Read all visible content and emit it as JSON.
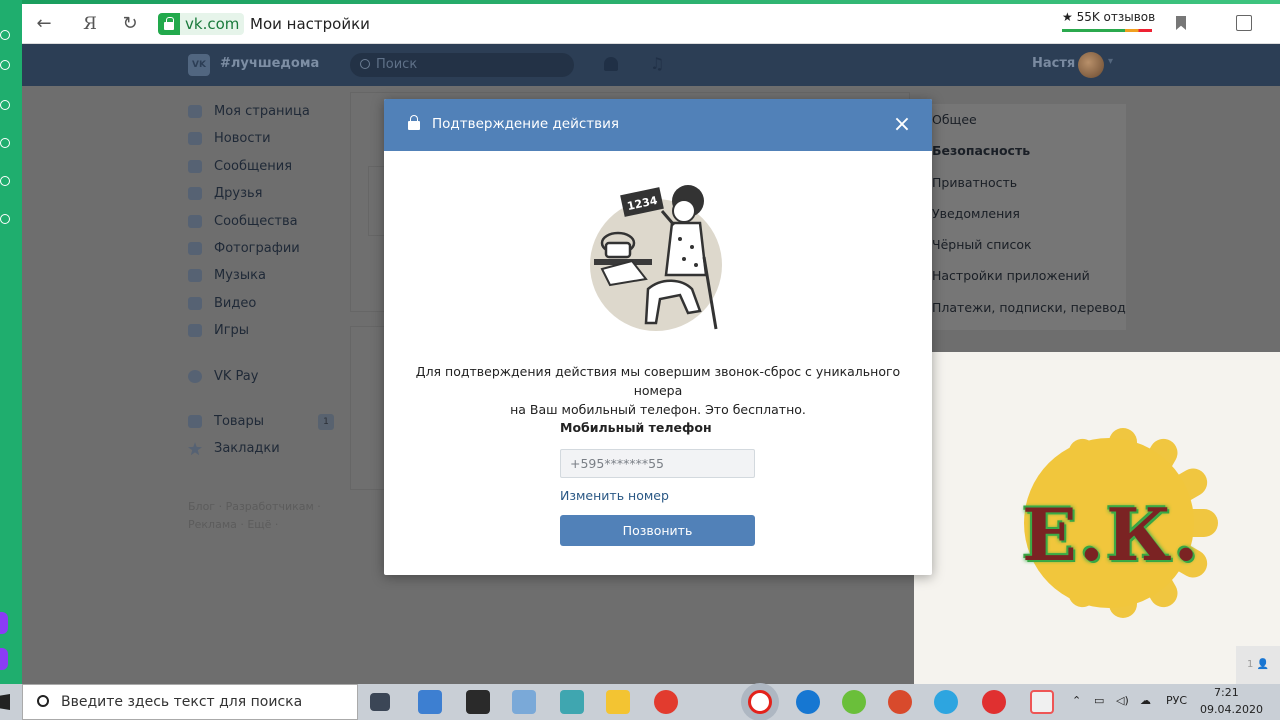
{
  "browser": {
    "domain": "vk.com",
    "page_title": "Мои настройки",
    "reviews": "★ 55K отзывов",
    "yandex_label": "Я"
  },
  "vk_header": {
    "logo": "VK",
    "hashtag": "#лучшедома",
    "search_placeholder": "Поиск",
    "user_name": "Настя"
  },
  "sidebar": {
    "items": [
      {
        "label": "Моя страница",
        "icon": "user-icon"
      },
      {
        "label": "Новости",
        "icon": "news-icon"
      },
      {
        "label": "Сообщения",
        "icon": "message-icon"
      },
      {
        "label": "Друзья",
        "icon": "friends-icon"
      },
      {
        "label": "Сообщества",
        "icon": "groups-icon"
      },
      {
        "label": "Фотографии",
        "icon": "photo-icon"
      },
      {
        "label": "Музыка",
        "icon": "music-icon"
      },
      {
        "label": "Видео",
        "icon": "video-icon"
      },
      {
        "label": "Игры",
        "icon": "games-icon"
      }
    ],
    "vkpay": "VK Pay",
    "goods": "Товары",
    "goods_badge": "1",
    "bookmarks": "Закладки",
    "footer_line1": "Блог · Разработчикам ·",
    "footer_line2": "Реклама · Ещё ·"
  },
  "settings_menu": {
    "items": [
      "Общее",
      "Безопасность",
      "Приватность",
      "Уведомления",
      "Чёрный список",
      "Настройки приложений",
      "Платежи, подписки, переводы"
    ],
    "active_index": 1
  },
  "modal": {
    "title": "Подтверждение действия",
    "close": "×",
    "illustration_number": "1234",
    "text_line1": "Для подтверждения действия мы совершим звонок-сброс с уникального номера",
    "text_line2": "на Ваш мобильный телефон. Это бесплатно.",
    "field_label": "Мобильный телефон",
    "phone_value": "+595*******55",
    "change_link": "Изменить номер",
    "call_button": "Позвонить"
  },
  "overlay_logo": {
    "text": "Е.К.",
    "corner": "1 👤"
  },
  "taskbar": {
    "search_placeholder": "Введите здесь текст для поиска",
    "lang": "РУС",
    "time": "7:21",
    "date": "09.04.2020"
  },
  "colors": {
    "vk_blue": "#5181b8",
    "vk_header": "#2c3e55",
    "browser_green": "#22a94c"
  }
}
